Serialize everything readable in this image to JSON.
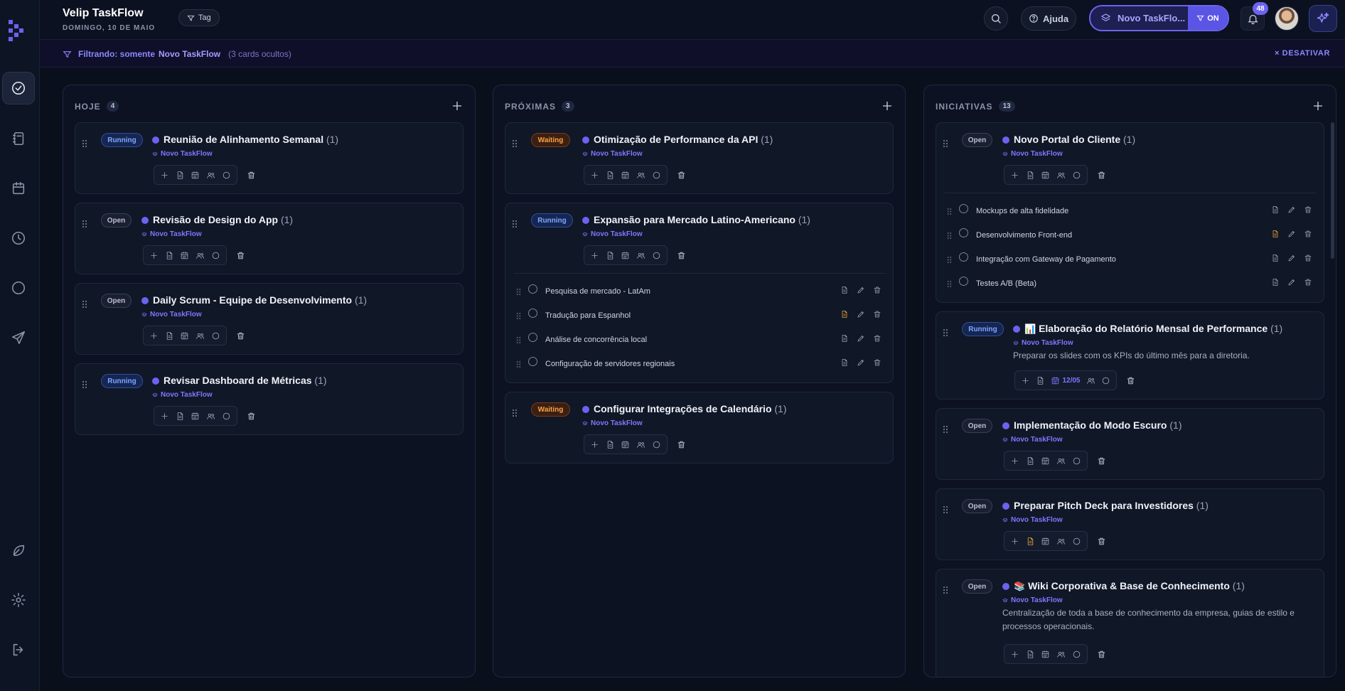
{
  "app": {
    "title": "Velip TaskFlow",
    "date": "DOMINGO, 10 DE MAIO"
  },
  "header": {
    "tag_label": "Tag",
    "help_label": "Ajuda",
    "project_label": "Novo TaskFlo...",
    "filter_toggle_label": "ON",
    "notification_count": "48"
  },
  "filterbar": {
    "prefix": "Filtrando: somente",
    "project": "Novo TaskFlow",
    "hidden": "(3 cards ocultos)",
    "deactivate": "DESATIVAR"
  },
  "sidebar": {
    "items": [
      "check-circle-icon",
      "notebook-icon",
      "calendar-icon",
      "clock-icon",
      "circle-icon",
      "send-icon"
    ],
    "bottom": [
      "leaf-icon",
      "gear-icon",
      "logout-icon"
    ]
  },
  "colors": {
    "accent": "#6b63f0",
    "running": "#7fa6ff",
    "waiting": "#ffa040",
    "background": "#0a0f1c"
  },
  "columns": [
    {
      "title": "HOJE",
      "count": "4",
      "cards": [
        {
          "status": "Running",
          "title": "Reunião de Alinhamento Semanal",
          "count": "(1)",
          "project": "Novo TaskFlow"
        },
        {
          "status": "Open",
          "title": "Revisão de Design do App",
          "count": "(1)",
          "project": "Novo TaskFlow"
        },
        {
          "status": "Open",
          "title": "Daily Scrum - Equipe de Desenvolvimento",
          "count": "(1)",
          "project": "Novo TaskFlow"
        },
        {
          "status": "Running",
          "title": "Revisar Dashboard de Métricas",
          "count": "(1)",
          "project": "Novo TaskFlow"
        }
      ]
    },
    {
      "title": "PRÓXIMAS",
      "count": "3",
      "cards": [
        {
          "status": "Waiting",
          "title": "Otimização de Performance da API",
          "count": "(1)",
          "project": "Novo TaskFlow"
        },
        {
          "status": "Running",
          "title": "Expansão para Mercado Latino-Americano",
          "count": "(1)",
          "project": "Novo TaskFlow",
          "subtasks": [
            "Pesquisa de mercado - LatAm",
            "Tradução para Espanhol",
            "Análise de concorrência local",
            "Configuração de servidores regionais"
          ]
        },
        {
          "status": "Waiting",
          "title": "Configurar Integrações de Calendário",
          "count": "(1)",
          "project": "Novo TaskFlow"
        }
      ]
    },
    {
      "title": "INICIATIVAS",
      "count": "13",
      "cards": [
        {
          "status": "Open",
          "title": "Novo Portal do Cliente",
          "count": "(1)",
          "project": "Novo TaskFlow",
          "subtasks": [
            "Mockups de alta fidelidade",
            "Desenvolvimento Front-end",
            "Integração com Gateway de Pagamento",
            "Testes A/B (Beta)"
          ]
        },
        {
          "status": "Running",
          "emoji": "📊",
          "title": "Elaboração do Relatório Mensal de Performance",
          "count": "(1)",
          "project": "Novo TaskFlow",
          "description": "Preparar os slides com os KPIs do último mês para a diretoria.",
          "date": "12/05"
        },
        {
          "status": "Open",
          "title": "Implementação do Modo Escuro",
          "count": "(1)",
          "project": "Novo TaskFlow"
        },
        {
          "status": "Open",
          "title": "Preparar Pitch Deck para Investidores",
          "count": "(1)",
          "project": "Novo TaskFlow"
        },
        {
          "status": "Open",
          "emoji": "📚",
          "title": "Wiki Corporativa & Base de Conhecimento",
          "count": "(1)",
          "project": "Novo TaskFlow",
          "description": "Centralização de toda a base de conhecimento da empresa, guias de estilo e processos operacionais."
        }
      ]
    }
  ]
}
